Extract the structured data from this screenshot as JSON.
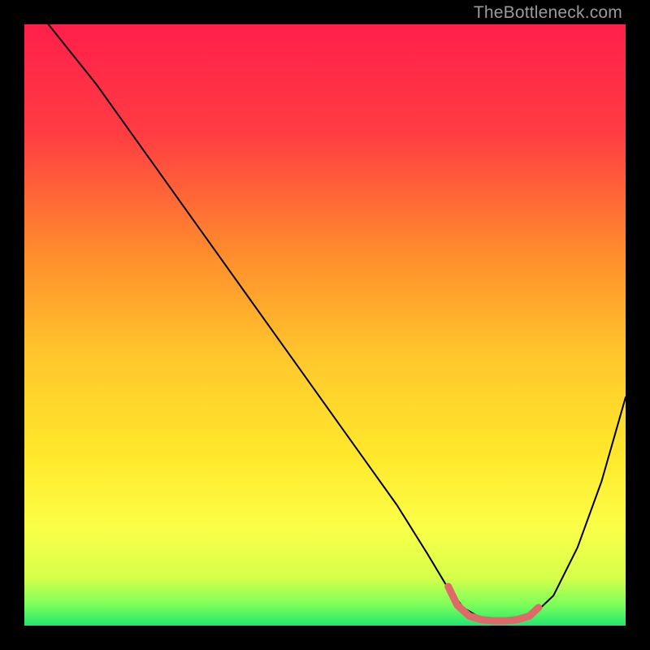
{
  "watermark": "TheBottleneck.com",
  "chart_data": {
    "type": "line",
    "title": "",
    "xlabel": "",
    "ylabel": "",
    "xlim": [
      0,
      100
    ],
    "ylim": [
      0,
      100
    ],
    "grid": false,
    "legend": false,
    "series": [
      {
        "name": "main-curve",
        "color": "#000000",
        "x": [
          4,
          8,
          12,
          17,
          22,
          27,
          32,
          37,
          42,
          47,
          52,
          57,
          62,
          67,
          70,
          73,
          76,
          79,
          82,
          84,
          88,
          92,
          96,
          100
        ],
        "y": [
          100,
          95,
          90,
          83,
          76,
          69,
          62,
          55,
          48,
          41,
          34,
          27,
          20,
          12,
          7,
          3,
          1.2,
          0.8,
          0.8,
          1.2,
          5,
          13,
          24,
          38
        ]
      },
      {
        "name": "highlight-band",
        "color": "#df6868",
        "x": [
          70.5,
          72,
          74,
          76,
          78,
          80,
          82,
          84,
          85.5
        ],
        "y": [
          6.5,
          3.4,
          1.6,
          1.0,
          0.8,
          0.8,
          1.0,
          1.6,
          3.0
        ]
      }
    ],
    "gradient_stops": [
      {
        "offset": 0.0,
        "color": "#ff1f4a"
      },
      {
        "offset": 0.18,
        "color": "#ff3c43"
      },
      {
        "offset": 0.38,
        "color": "#ff8c2c"
      },
      {
        "offset": 0.56,
        "color": "#ffc92c"
      },
      {
        "offset": 0.72,
        "color": "#ffe92c"
      },
      {
        "offset": 0.84,
        "color": "#faff48"
      },
      {
        "offset": 0.92,
        "color": "#d6ff4a"
      },
      {
        "offset": 0.965,
        "color": "#7dff5a"
      },
      {
        "offset": 1.0,
        "color": "#21e66f"
      }
    ]
  }
}
